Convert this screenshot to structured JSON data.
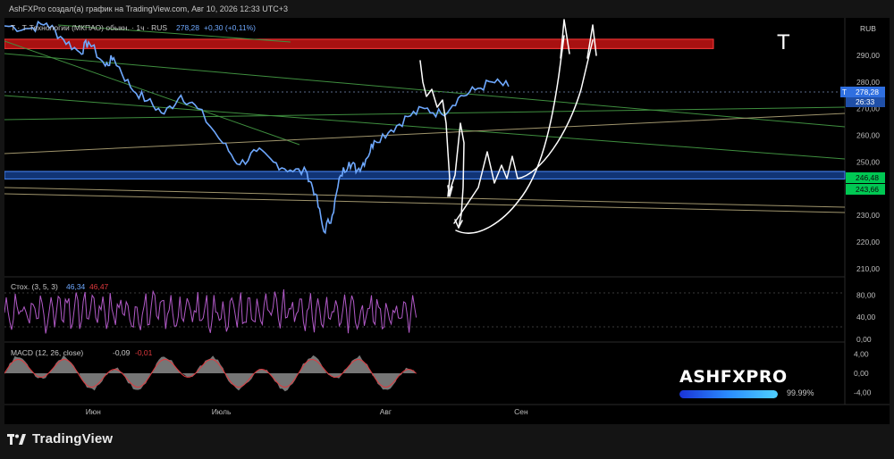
{
  "header": {
    "caption": "AshFXPro создал(а) график на TradingView.com, Авг 10, 2026 12:33 UTC+3"
  },
  "symbol": {
    "legend_prefix": "T · Т-Технологии (МКПАО) обыкн. · 1ч · RUS",
    "last_price": "278,28",
    "change": "+0,30 (+0,11%)",
    "ticker_watermark": "T"
  },
  "price_axis": {
    "currency": "RUB",
    "last_price_tag": "278,28",
    "countdown": "26:33",
    "tag_letter": "T",
    "zone_upper_tag": "246,48",
    "zone_lower_tag": "243,66"
  },
  "stoch": {
    "label": "Стох. (3, 5, 3)",
    "k_value": "46,34",
    "d_value": "46,47"
  },
  "macd": {
    "label": "MACD (12, 26, close)",
    "hist_value": "-0,09",
    "signal_value": "-0,01"
  },
  "branding": {
    "name": "ASHFXPRO",
    "progress_label": "99.99%",
    "progress": 0.9999
  },
  "footer": {
    "logo_text": "TradingView"
  },
  "colors": {
    "price_line": "#6ea8fe",
    "stoch_line": "#b25ac8",
    "macd_area": "#9e9e9e",
    "macd_signal": "#e0393e",
    "red_zone": "#b11212",
    "blue_zone": "#1f5fd6",
    "trend_green": "#3f8f3f",
    "trend_tan": "#a0956c",
    "projection": "#ffffff",
    "last_price_tag": "#2f6fe0",
    "zone_tag": "#00c853"
  },
  "chart_data": [
    {
      "type": "line",
      "title": "T · Т-Технологии (МКПАО) обыкн. · 1ч · RUS",
      "timeframe": "1ч",
      "x_labels": [
        "Июн",
        "Июль",
        "Авг",
        "Сен"
      ],
      "y_ticks": [
        210,
        220,
        230,
        240,
        250,
        260,
        270,
        280,
        290
      ],
      "y_tick_labels": [
        "210,00",
        "220,00",
        "230,00",
        "240,00",
        "250,00",
        "260,00",
        "270,00",
        "280,00",
        "290,00"
      ],
      "ylim": [
        207,
        304
      ],
      "series": [
        {
          "role": "price",
          "points": [
            [
              0.0,
              301
            ],
            [
              0.03,
              300
            ],
            [
              0.05,
              302
            ],
            [
              0.07,
              296
            ],
            [
              0.09,
              291
            ],
            [
              0.1,
              295
            ],
            [
              0.12,
              286
            ],
            [
              0.13,
              289
            ],
            [
              0.15,
              278
            ],
            [
              0.17,
              273
            ],
            [
              0.19,
              268
            ],
            [
              0.21,
              275
            ],
            [
              0.23,
              270
            ],
            [
              0.26,
              257
            ],
            [
              0.28,
              249
            ],
            [
              0.3,
              254
            ],
            [
              0.32,
              250
            ],
            [
              0.34,
              247
            ],
            [
              0.36,
              246
            ],
            [
              0.37,
              238
            ],
            [
              0.38,
              224
            ],
            [
              0.39,
              230
            ],
            [
              0.4,
              245
            ],
            [
              0.41,
              250
            ],
            [
              0.42,
              247
            ],
            [
              0.43,
              251
            ],
            [
              0.44,
              258
            ],
            [
              0.46,
              262
            ],
            [
              0.48,
              267
            ],
            [
              0.5,
              270
            ],
            [
              0.52,
              268
            ],
            [
              0.54,
              274
            ],
            [
              0.56,
              277
            ],
            [
              0.58,
              280
            ],
            [
              0.6,
              278.28
            ]
          ]
        }
      ],
      "zones": [
        {
          "name": "resistance",
          "color": "red",
          "y_from": 292.5,
          "y_to": 296
        },
        {
          "name": "support",
          "color": "blue",
          "y_from": 243.66,
          "y_to": 246.48
        }
      ],
      "last_price": 278.28,
      "projection": "white hand-drawn path: drop to ~228 then rally through 296"
    },
    {
      "type": "line",
      "title": "Стох. (3, 5, 3)",
      "y_ticks": [
        0,
        40,
        80
      ],
      "y_tick_labels": [
        "0,00",
        "40,00",
        "80,00"
      ],
      "ylim": [
        0,
        100
      ],
      "k_last": 46.34,
      "d_last": 46.47
    },
    {
      "type": "area",
      "title": "MACD (12, 26, close)",
      "y_ticks": [
        -4,
        0,
        4
      ],
      "y_tick_labels": [
        "-4,00",
        "0,00",
        "4,00"
      ],
      "ylim": [
        -6,
        6
      ],
      "hist_last": -0.09,
      "signal_last": -0.01
    }
  ]
}
